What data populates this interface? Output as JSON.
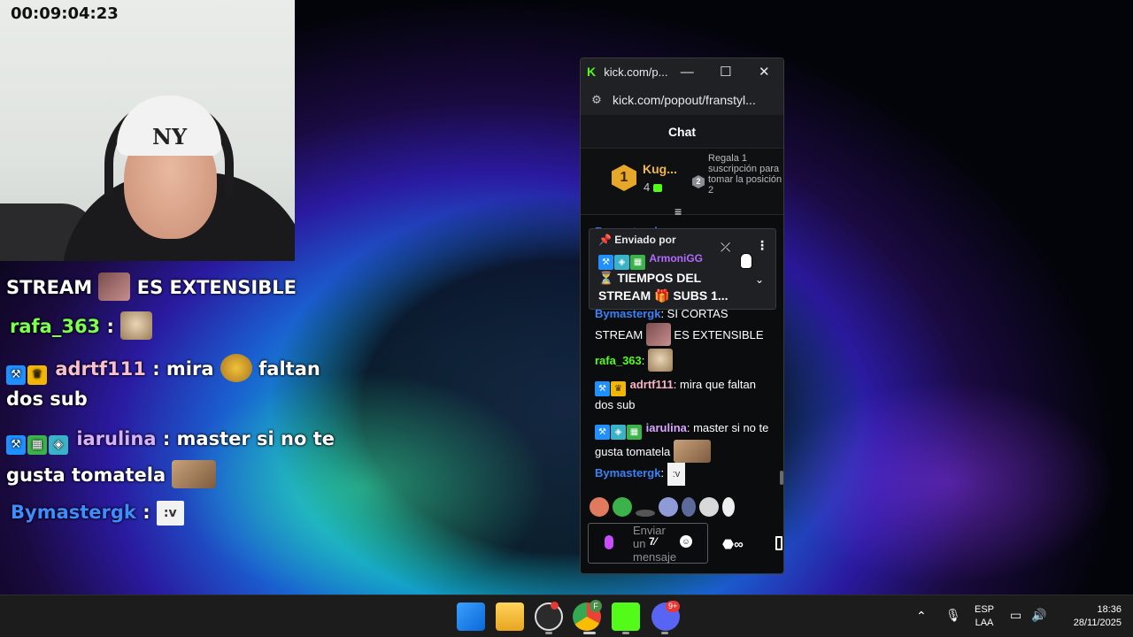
{
  "webcam": {
    "timer": "00:09:04:23",
    "cap_logo": "NY"
  },
  "overlay_chat": {
    "line1": {
      "text1": "STREAM",
      "text2": "ES EXTENSIBLE"
    },
    "line2": {
      "user": "rafa_363",
      "sep": " :"
    },
    "line3": {
      "user": "adrtf111",
      "text1": " : mira",
      "text2": "faltan"
    },
    "line4": {
      "text": "dos sub"
    },
    "line5": {
      "user": "iarulina",
      "text": " : master si no te"
    },
    "line6": {
      "text": "gusta tomatela"
    },
    "line7": {
      "user": "Bymastergk",
      "sep": " :",
      "emote": ":v"
    }
  },
  "popup": {
    "tab_title": "kick.com/p...",
    "url": "kick.com/popout/franstyl...",
    "chat_header": "Chat",
    "leaderboard": {
      "rank1": "1",
      "rank1_name": "Kug...",
      "rank1_count": "4",
      "rank2": "2",
      "promo": "Regala 1 suscripción para tomar la posición 2"
    },
    "pinned": {
      "header": "Enviado por",
      "user": "ArmoniGG",
      "text_line1": "⏳ TIEMPOS DEL",
      "text_line2": "STREAM 🎁 SUBS 1..."
    },
    "messages": [
      {
        "user": "Bymastergk",
        "text1": ": SI CORTAS",
        "text2": "STREAM",
        "text3": "ES EXTENSIBLE",
        "color": "#3b82f6"
      },
      {
        "user": "rafa_363",
        "text1": ":",
        "color": "#53fc18"
      },
      {
        "user": "adrtf111",
        "text1": ": mira que faltan dos sub",
        "color": "#f8b4c4"
      },
      {
        "user": "iarulina",
        "text1": ": master si no te gusta tomatela",
        "color": "#d8a6ff"
      },
      {
        "user": "Bymastergk",
        "text1": ":",
        "emote": ":v",
        "color": "#3b82f6"
      }
    ],
    "input_placeholder": "Enviar un mensaje"
  },
  "taskbar": {
    "lang_line1": "ESP",
    "lang_line2": "LAA",
    "time": "18:36",
    "date": "28/11/2025",
    "discord_badge": "9+"
  },
  "colors": {
    "kick_green": "#53fc18",
    "overlay_rafa": "#7dff4f",
    "overlay_adrtf": "#f8c0d0",
    "overlay_iarulina": "#d9b0ff",
    "overlay_bymaster": "#3f8cff"
  }
}
